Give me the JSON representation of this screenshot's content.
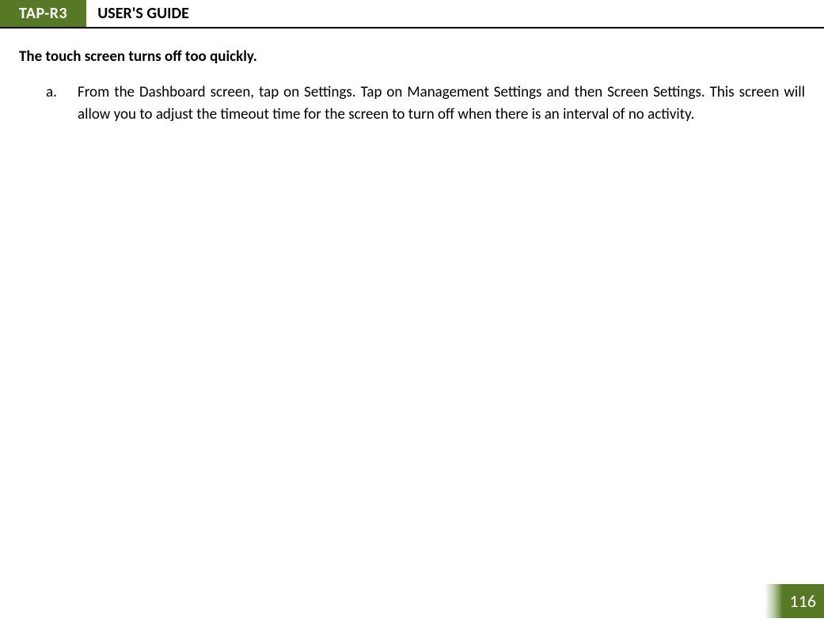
{
  "header": {
    "tab": "TAP-R3",
    "title": "USER'S GUIDE"
  },
  "section": {
    "heading": "The touch screen turns off too quickly.",
    "items": [
      {
        "marker": "a.",
        "text": "From the Dashboard screen, tap on Settings.  Tap on Management Settings and then Screen Settings.  This screen will allow you to adjust the timeout time for the screen to turn off when there is an interval of no activity."
      }
    ]
  },
  "page_number": "116"
}
